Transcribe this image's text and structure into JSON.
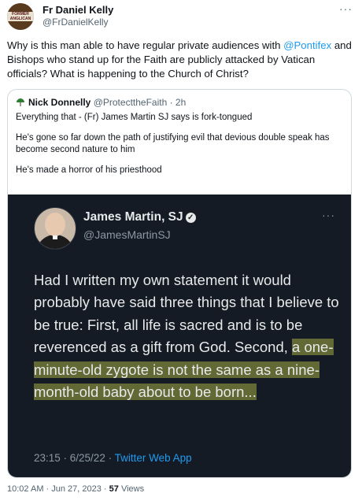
{
  "author": {
    "name": "Fr Daniel Kelly",
    "handle": "@FrDanielKelly",
    "avatar_text": "FORMER ANGLICAN"
  },
  "more_icon": "···",
  "tweet": {
    "text_pre": "Why is this man able to have regular private audiences with ",
    "mention": "@Pontifex",
    "text_post": " and Bishops who stand up for the Faith are publicly attacked by Vatican officials? What is happening to the Church of Christ?"
  },
  "quote": {
    "name": "Nick Donnelly",
    "handle_time": "@ProtecttheFaith · 2h",
    "lines": [
      "Everything that - (Fr) James Martin SJ says is fork-tongued",
      "He's gone so far down the path of justifying evil that devious double speak has become second nature to him",
      "He's made a horror of his priesthood"
    ],
    "media": {
      "name": "James Martin, SJ",
      "handle": "@JamesMartinSJ",
      "body_plain": "Had I written my own statement it would probably have said three things that I believe to be true: First, all life is sacred and is to be reverenced as a gift from God. Second, ",
      "body_highlight": "a one-minute-old zygote is not the same as a nine-month-old baby about to be born...",
      "timestamp": "23:15 · 6/25/22 · ",
      "source": "Twitter Web App"
    }
  },
  "footer": {
    "time": "10:02 AM · Jun 27, 2023 · ",
    "views_count": "57",
    "views_label": " Views"
  },
  "colors": {
    "link": "#1d9bf0",
    "media_bg": "#151b24",
    "highlight": "#d6de50"
  }
}
